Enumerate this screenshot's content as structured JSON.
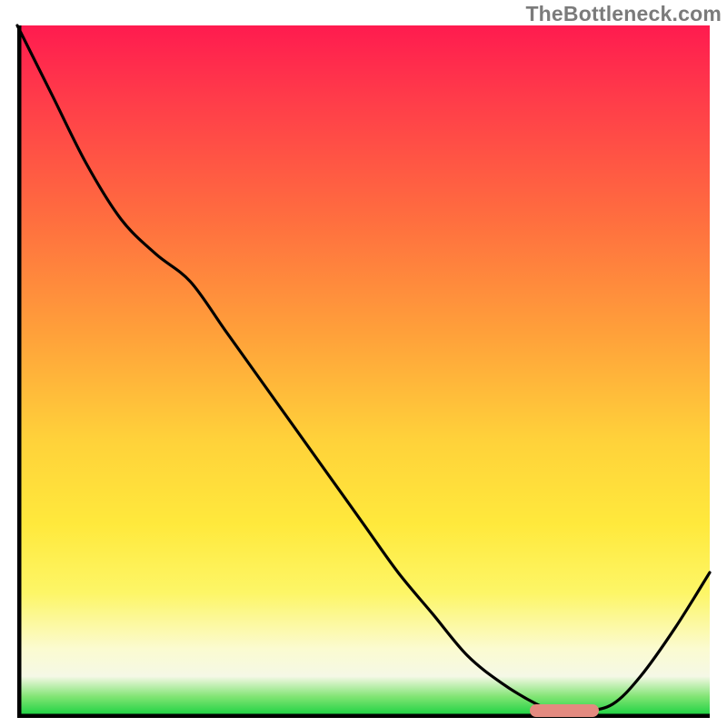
{
  "watermark": {
    "text": "TheBottleneck.com"
  },
  "colors": {
    "gradient_top": "#ff1b4f",
    "gradient_mid1": "#ffa23a",
    "gradient_mid2": "#ffe93c",
    "gradient_pale": "#fbfbd0",
    "gradient_bottom": "#0dcf3a",
    "curve_stroke": "#000000",
    "marker_fill": "#e38a80",
    "axis_stroke": "#000000"
  },
  "chart_data": {
    "type": "line",
    "title": "",
    "xlabel": "",
    "ylabel": "",
    "grid": false,
    "legend": false,
    "x": [
      0.0,
      0.05,
      0.1,
      0.15,
      0.2,
      0.25,
      0.3,
      0.35,
      0.4,
      0.45,
      0.5,
      0.55,
      0.6,
      0.65,
      0.7,
      0.75,
      0.78,
      0.82,
      0.86,
      0.9,
      0.95,
      1.0
    ],
    "values": [
      100,
      90,
      80,
      72,
      67,
      63,
      56,
      49,
      42,
      35,
      28,
      21,
      15,
      9,
      5,
      2,
      1,
      1,
      2,
      6,
      13,
      21
    ],
    "xlim": [
      0,
      1
    ],
    "ylim": [
      0,
      100
    ],
    "series": [
      {
        "name": "curve",
        "values_ref": "values"
      }
    ],
    "marker": {
      "x_start": 0.74,
      "x_end": 0.84,
      "y": 1
    }
  }
}
